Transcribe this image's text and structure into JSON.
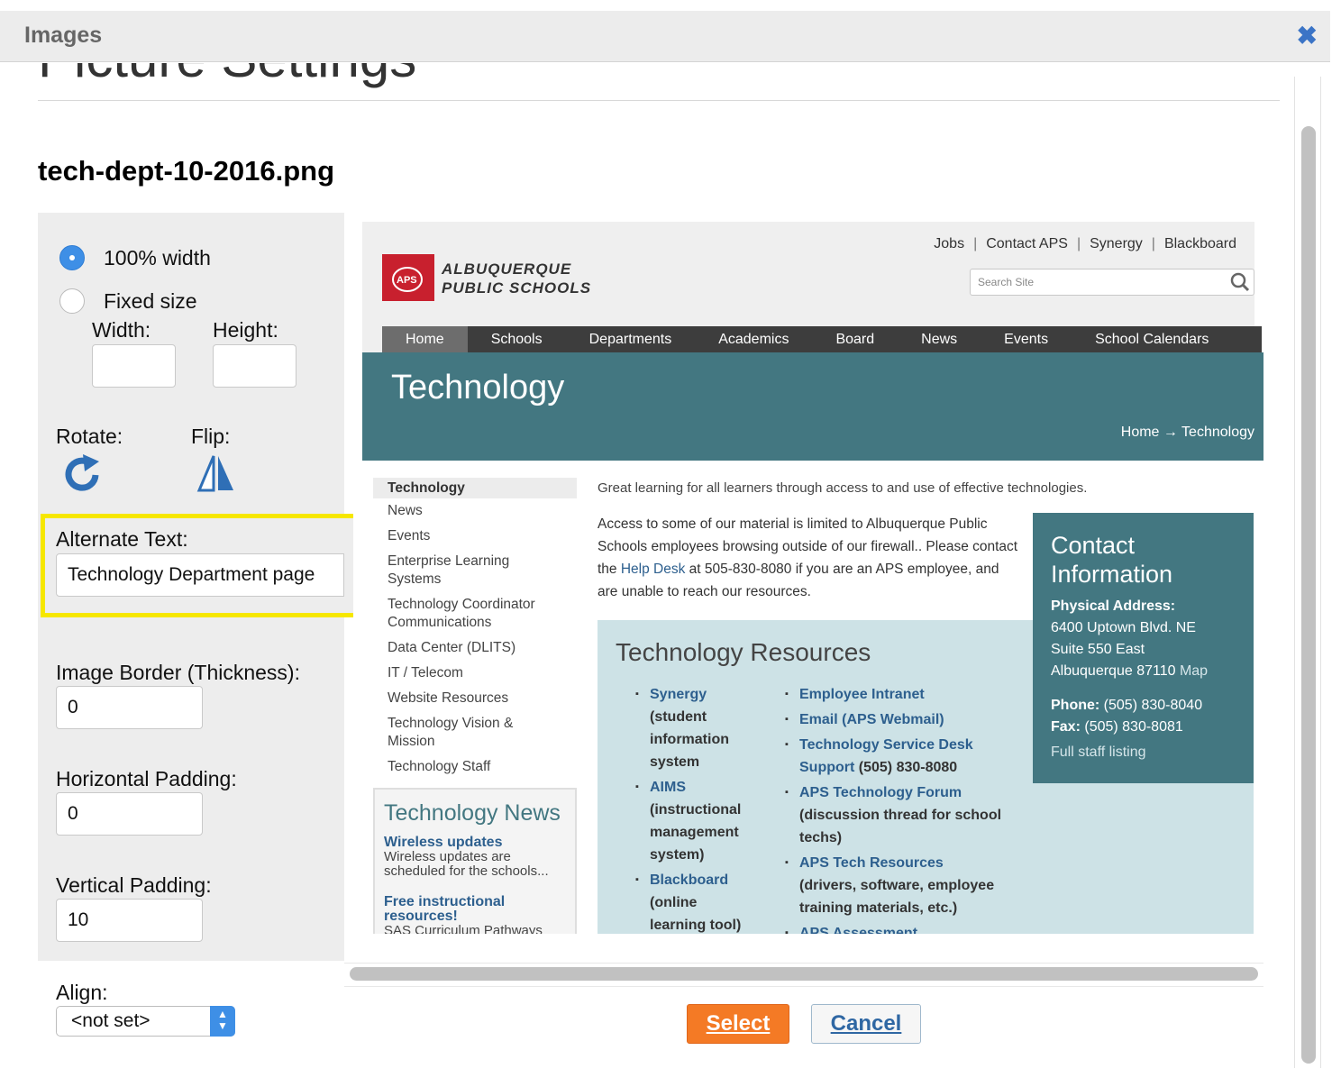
{
  "dialog": {
    "title": "Images",
    "close_glyph": "✖"
  },
  "heading": "Picture Settings",
  "filename": "tech-dept-10-2016.png",
  "settings": {
    "width_option_full": "100% width",
    "width_option_fixed": "Fixed size",
    "width_label": "Width:",
    "height_label": "Height:",
    "width_value": "",
    "height_value": "",
    "rotate_label": "Rotate:",
    "flip_label": "Flip:",
    "alt_label": "Alternate Text:",
    "alt_value": "Technology Department page",
    "border_label": "Image Border (Thickness):",
    "border_value": "0",
    "hpad_label": "Horizontal Padding:",
    "hpad_value": "0",
    "vpad_label": "Vertical Padding:",
    "vpad_value": "10",
    "align_label": "Align:",
    "align_value": "<not set>"
  },
  "preview": {
    "top_links": [
      "Jobs",
      "Contact APS",
      "Synergy",
      "Blackboard"
    ],
    "search_placeholder": "Search Site",
    "logo_line1": "ALBUQUERQUE",
    "logo_line2": "PUBLIC SCHOOLS",
    "logo_mark": "APS",
    "nav": [
      "Home",
      "Schools",
      "Departments",
      "Academics",
      "Board",
      "News",
      "Events",
      "School Calendars"
    ],
    "banner_title": "Technology",
    "breadcrumb": "Home → Technology",
    "side_heading": "Technology",
    "side_items": [
      "News",
      "Events",
      "Enterprise Learning Systems",
      "Technology Coordinator Communications",
      "Data Center (DLITS)",
      "IT / Telecom",
      "Website Resources",
      "Technology Vision & Mission",
      "Technology Staff"
    ],
    "news_title": "Technology News",
    "news": [
      {
        "link": "Wireless updates",
        "desc": "Wireless updates are scheduled for the schools..."
      },
      {
        "link": "Free instructional resources!",
        "desc": "SAS Curriculum Pathways"
      }
    ],
    "intro": "Great learning for all learners through access to and use of effective technologies.",
    "access_1": "Access to some of our material is limited to Albuquerque Public Schools employees browsing outside of our firewall.. Please contact the ",
    "access_link": "Help Desk",
    "access_2": " at 505-830-8080 if you are an APS employee, and are unable to reach our resources.",
    "resources_title": "Technology Resources",
    "resources_left": [
      {
        "link": "Synergy",
        "desc": "(student information system"
      },
      {
        "link": "AIMS",
        "desc": "(instructional management system)"
      },
      {
        "link": "Blackboard",
        "desc": "(online learning tool)"
      }
    ],
    "resources_right": [
      {
        "link": "Employee Intranet",
        "desc": ""
      },
      {
        "link": "Email (APS Webmail)",
        "desc": ""
      },
      {
        "link": "Technology Service Desk Support",
        "desc": "(505) 830-8080"
      },
      {
        "link": "APS Technology Forum",
        "desc": "(discussion thread for school techs)"
      },
      {
        "link": "APS Tech Resources",
        "desc": "(drivers, software, employee training materials, etc.)"
      },
      {
        "link": "APS Assessment",
        "desc": ""
      }
    ],
    "contact_title": "Contact Information",
    "contact_address_label": "Physical Address:",
    "contact_address_1": "6400 Uptown Blvd. NE",
    "contact_address_2": "Suite 550 East",
    "contact_address_3": "Albuquerque 87110",
    "contact_map": "Map",
    "contact_phone_label": "Phone:",
    "contact_phone": "(505) 830-8040",
    "contact_fax_label": "Fax:",
    "contact_fax": "(505) 830-8081",
    "contact_staff": "Full staff listing"
  },
  "buttons": {
    "select": "Select",
    "cancel": "Cancel"
  },
  "colors": {
    "accent": "#3e8fe6",
    "highlight": "#f6e700",
    "select_button": "#f47a25",
    "banner": "#437781"
  },
  "icons": {
    "close": "close-icon",
    "rotate": "rotate-icon",
    "flip": "flip-icon",
    "search": "search-icon"
  }
}
